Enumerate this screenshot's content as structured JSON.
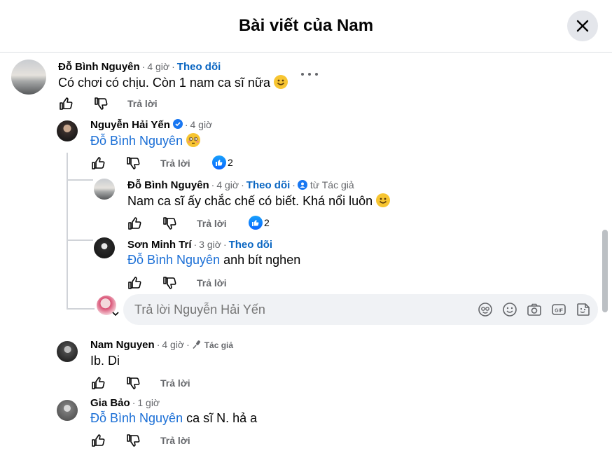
{
  "header": {
    "title": "Bài viết của Nam"
  },
  "icons": {
    "close": "close-icon",
    "like": "like-icon",
    "dislike": "dislike-icon",
    "more": "more-icon",
    "verified": "verified-badge-icon",
    "mic": "mic-icon"
  },
  "colors": {
    "link": "#1b6fd6",
    "follow": "#0a66c2",
    "secondary": "#65676b",
    "reaction": "#0a66ff"
  },
  "comments": [
    {
      "name": "Đỗ Bình Nguyên",
      "time": "4 giờ",
      "follow": "Theo dõi",
      "text": "Có chơi có chịu. Còn 1 nam ca sĩ nữa",
      "reply": "Trả lời"
    },
    {
      "name": "Nguyễn Hải Yến",
      "time": "4 giờ",
      "mention": "Đỗ Bình Nguyên",
      "reply": "Trả lời",
      "reactions": "2"
    },
    {
      "name": "Đỗ Bình Nguyên",
      "time": "4 giờ",
      "follow": "Theo dõi",
      "badge": "từ Tác giả",
      "text": "Nam ca sĩ ấy chắc chế có biết. Khá nổi luôn",
      "reply": "Trả lời",
      "reactions": "2"
    },
    {
      "name": "Sơn Minh Trí",
      "time": "3 giờ",
      "follow": "Theo dõi",
      "mention": "Đỗ Bình Nguyên",
      "text": "anh bít nghen",
      "reply": "Trả lời"
    },
    {
      "name": "Nam Nguyen",
      "time": "4 giờ",
      "badge": "Tác giả",
      "text": "Ib. Di",
      "reply": "Trả lời"
    },
    {
      "name": "Gia Bảo",
      "time": "1 giờ",
      "mention": "Đỗ Bình Nguyên",
      "text": "ca sĩ N. hả a",
      "reply": "Trả lời"
    }
  ],
  "reply_box": {
    "placeholder": "Trả lời Nguyễn Hải Yến"
  }
}
